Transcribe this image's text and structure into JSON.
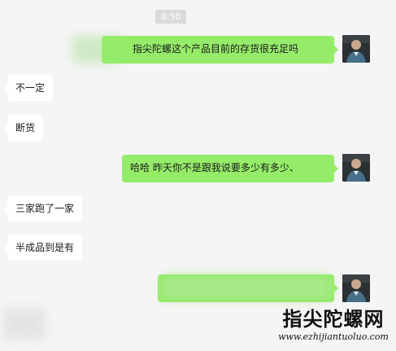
{
  "timestamp": "8:50",
  "messages": [
    {
      "side": "right",
      "text": "指尖陀螺这个产品目前的存货很充足吗"
    },
    {
      "side": "left",
      "text": "不一定"
    },
    {
      "side": "left",
      "text": "断货"
    },
    {
      "side": "right",
      "text": "哈哈 昨天你不是跟我说要多少有多少、"
    },
    {
      "side": "left",
      "text": "三家跑了一家"
    },
    {
      "side": "left",
      "text": "半成品到是有"
    },
    {
      "side": "right",
      "text": ""
    }
  ],
  "watermark": {
    "title": "指尖陀螺网",
    "url": "www.ezhijiantuoluo.com"
  },
  "colors": {
    "background": "#f5f5f5",
    "outgoing_bubble": "#95ec69",
    "incoming_bubble": "#ffffff",
    "timestamp_bg": "#dadada"
  }
}
